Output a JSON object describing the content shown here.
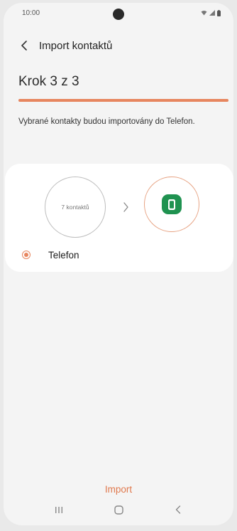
{
  "status_bar": {
    "time": "10:00"
  },
  "app_bar": {
    "title": "Import kontaktů"
  },
  "step": {
    "label": "Krok 3 z 3",
    "progress": 1.0
  },
  "description": "Vybrané kontakty budou importovány do Telefon.",
  "transfer": {
    "source_label": "7 kontaktů"
  },
  "destination_option": {
    "label": "Telefon",
    "selected": true
  },
  "import_button": {
    "label": "Import"
  },
  "colors": {
    "accent": "#e7865f",
    "phone_icon_bg": "#1f9250"
  },
  "icons": {
    "back": "chevron-left-icon",
    "arrow": "chevron-right-icon",
    "phone": "phone-icon",
    "nav_recents": "recents-icon",
    "nav_home": "home-icon",
    "nav_back": "back-icon"
  }
}
